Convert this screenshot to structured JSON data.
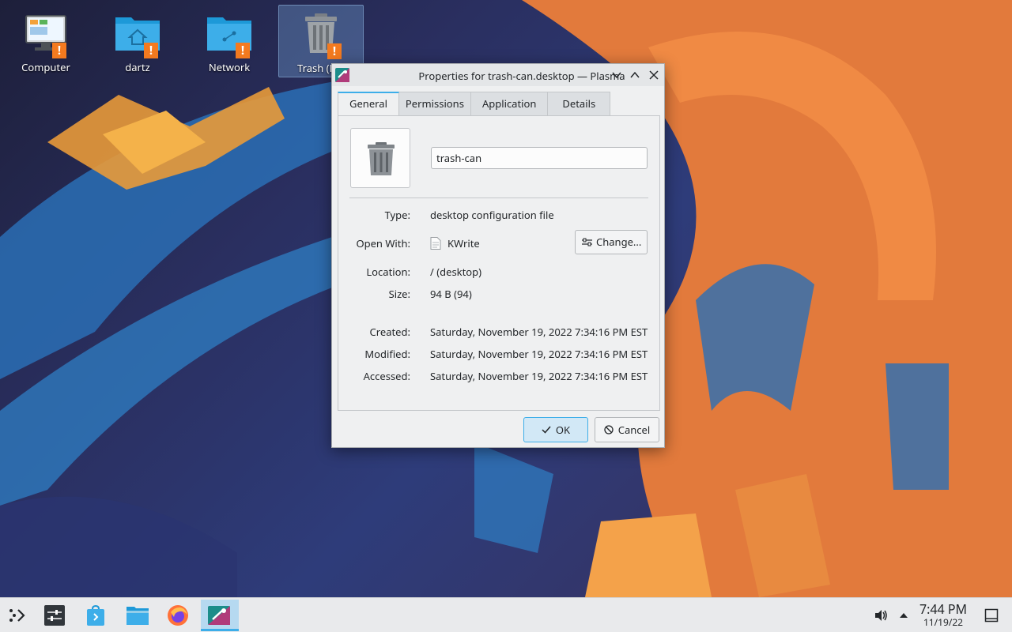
{
  "desktop": {
    "icons": [
      {
        "label": "Computer"
      },
      {
        "label": "dartz"
      },
      {
        "label": "Network"
      },
      {
        "label": "Trash (Em"
      }
    ],
    "warning_glyph": "!"
  },
  "dialog": {
    "title": "Properties for trash-can.desktop — Plasma",
    "controls": {
      "minimize": "⌄",
      "maximize": "⌃",
      "close": "✕"
    },
    "tabs": [
      {
        "label": "General",
        "active": true
      },
      {
        "label": "Permissions",
        "active": false
      },
      {
        "label": "Application",
        "active": false
      },
      {
        "label": "Details",
        "active": false
      }
    ],
    "name_value": "trash-can",
    "fields": {
      "type_label": "Type:",
      "type_value": "desktop configuration file",
      "open_with_label": "Open With:",
      "open_with_value": "KWrite",
      "change_label": "Change...",
      "location_label": "Location:",
      "location_value": "/ (desktop)",
      "size_label": "Size:",
      "size_value": "94 B (94)",
      "created_label": "Created:",
      "created_value": "Saturday, November 19, 2022 7:34:16 PM EST",
      "modified_label": "Modified:",
      "modified_value": "Saturday, November 19, 2022 7:34:16 PM EST",
      "accessed_label": "Accessed:",
      "accessed_value": "Saturday, November 19, 2022 7:34:16 PM EST"
    },
    "buttons": {
      "ok": "OK",
      "cancel": "Cancel"
    }
  },
  "taskbar": {
    "apps": [
      "application-launcher-icon",
      "system-settings-icon",
      "discover-store-icon",
      "file-manager-icon",
      "firefox-icon",
      "properties-dialog-icon"
    ],
    "tray": {
      "volume": "volume-icon",
      "expand": "tray-expand-icon"
    },
    "clock": {
      "time": "7:44 PM",
      "date": "11/19/22"
    },
    "show_desktop": "show-desktop-icon"
  },
  "colors": {
    "accent": "#3daee9",
    "warning": "#f47a1f",
    "folder": "#3daee9",
    "window_bg": "#eff0f1"
  }
}
